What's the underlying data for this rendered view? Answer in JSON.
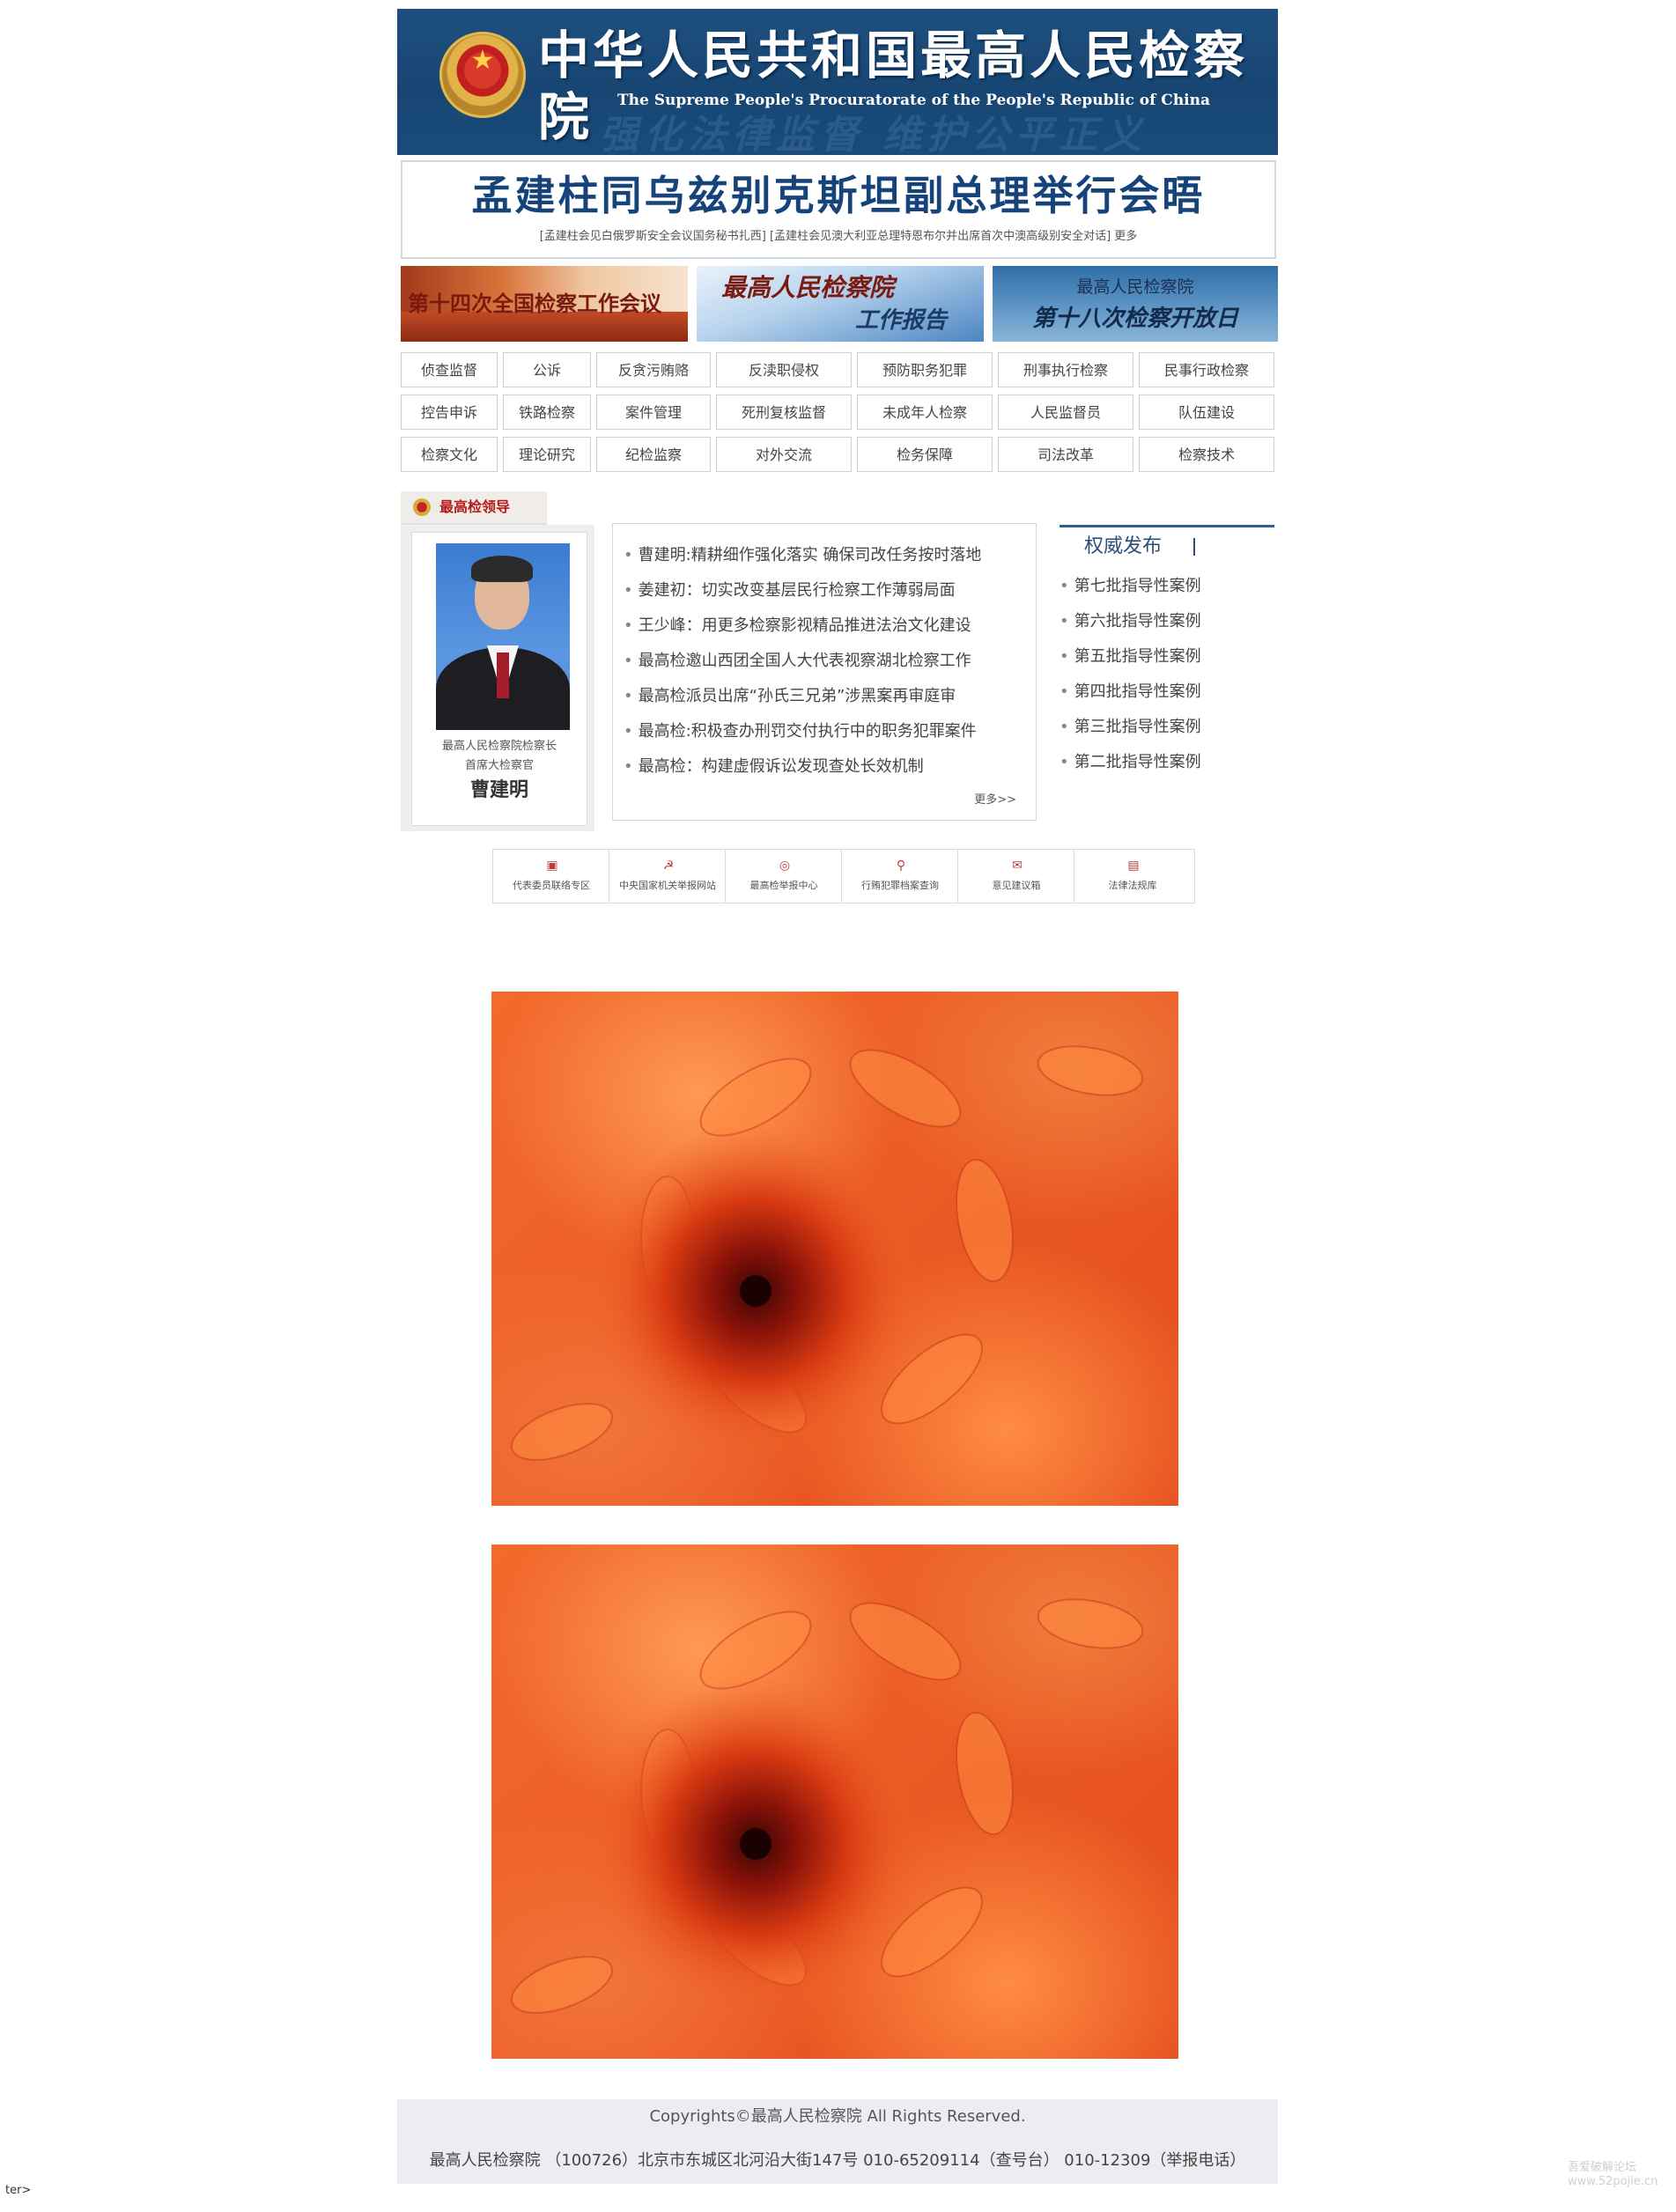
{
  "header": {
    "title": "中华人民共和国最高人民检察院",
    "subtitle": "The Supreme People's Procuratorate of the People's Republic of China",
    "slogan": "强化法律监督  维护公平正义"
  },
  "headline": {
    "title": "孟建柱同乌兹别克斯坦副总理举行会晤",
    "links": "[孟建柱会见白俄罗斯安全会议国务秘书扎西] [孟建柱会见澳大利亚总理特恩布尔并出席首次中澳高级别安全对话] 更多"
  },
  "banners": {
    "b1": "第十四次全国检察工作会议",
    "b2_line1": "最高人民检察院",
    "b2_line2": "工作报告",
    "b3_line1": "最高人民检察院",
    "b3_line2": "第十八次检察开放日"
  },
  "categories": {
    "row1": [
      "侦查监督",
      "公诉",
      "反贪污贿赂",
      "反渎职侵权",
      "预防职务犯罪",
      "刑事执行检察",
      "民事行政检察"
    ],
    "row2": [
      "控告申诉",
      "铁路检察",
      "案件管理",
      "死刑复核监督",
      "未成年人检察",
      "人民监督员",
      "队伍建设"
    ],
    "row3": [
      "检察文化",
      "理论研究",
      "纪检监察",
      "对外交流",
      "检务保障",
      "司法改革",
      "检察技术"
    ]
  },
  "leader": {
    "tab_label": "最高检领导",
    "title_line1": "最高人民检察院检察长",
    "title_line2": "首席大检察官",
    "name": "曹建明"
  },
  "news": {
    "items": [
      "曹建明:精耕细作强化落实 确保司改任务按时落地",
      "姜建初：切实改变基层民行检察工作薄弱局面",
      "王少峰：用更多检察影视精品推进法治文化建设",
      "最高检邀山西团全国人大代表视察湖北检察工作",
      "最高检派员出席“孙氏三兄弟”涉黑案再审庭审",
      "最高检:积极查办刑罚交付执行中的职务犯罪案件",
      "最高检：构建虚假诉讼发现查处长效机制"
    ],
    "more": "更多>>"
  },
  "authority": {
    "label": "权威发布",
    "items": [
      "第七批指导性案例",
      "第六批指导性案例",
      "第五批指导性案例",
      "第四批指导性案例",
      "第三批指导性案例",
      "第二批指导性案例"
    ]
  },
  "quick_links": [
    {
      "label": "代表委员联络专区",
      "icon": "id-card-icon"
    },
    {
      "label": "中央国家机关举报网站",
      "icon": "party-emblem-icon"
    },
    {
      "label": "最高检举报中心",
      "icon": "report-center-icon"
    },
    {
      "label": "行贿犯罪档案查询",
      "icon": "magnifier-icon"
    },
    {
      "label": "意见建议箱",
      "icon": "mailbox-icon"
    },
    {
      "label": "法律法规库",
      "icon": "law-book-icon"
    }
  ],
  "footer": {
    "copyright": "Copyrights©最高人民检察院 All Rights Reserved.",
    "address": "最高人民检察院 （100726）北京市东城区北河沿大街147号 010-65209114（查号台） 010-12309（举报电话）"
  },
  "corner_text": "ter>",
  "watermark": "吾爱破解论坛 www.52pojie.cn",
  "colors": {
    "header_bg": "#1a4b79",
    "headline_text": "#16447a",
    "accent_red": "#b41a1a",
    "flower_orange": "#f26a2c"
  }
}
